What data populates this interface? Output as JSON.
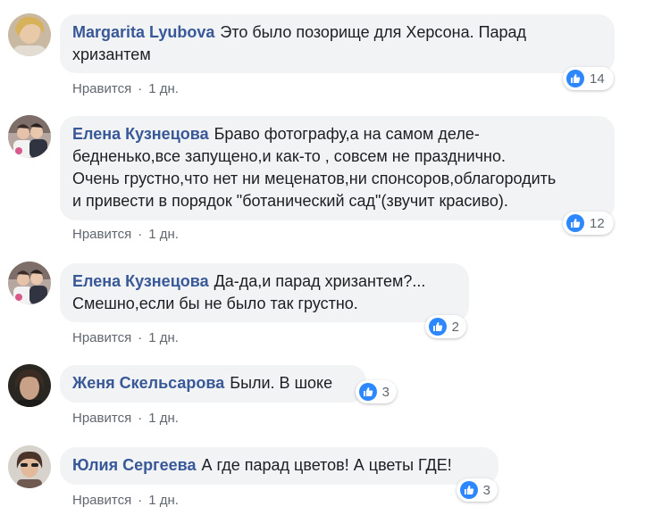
{
  "comments": [
    {
      "author": "Margarita Lyubova",
      "lines": [
        "Это было позорище для Херсона. Парад",
        "хризантем"
      ],
      "likes": "14",
      "action": "Нравится",
      "time": "1 дн."
    },
    {
      "author": "Елена Кузнецова",
      "lines": [
        "Браво фотографу,а на самом деле-",
        "бедненько,все запущено,и как-то , совсем не празднично.",
        "Очень грустно,что нет ни меценатов,ни спонсоров,облагородить",
        "и привести в порядок \"ботанический сад\"(звучит красиво)."
      ],
      "likes": "12",
      "action": "Нравится",
      "time": "1 дн."
    },
    {
      "author": "Елена Кузнецова",
      "lines": [
        "Да-да,и парад хризантем?...",
        "Смешно,если бы не было так грустно."
      ],
      "likes": "2",
      "action": "Нравится",
      "time": "1 дн."
    },
    {
      "author": "Женя Скельсарова",
      "lines": [
        "Были. В шоке"
      ],
      "likes": "3",
      "action": "Нравится",
      "time": "1 дн."
    },
    {
      "author": "Юлия Сергеева",
      "lines": [
        "А где парад цветов! А цветы ГДЕ!"
      ],
      "likes": "3",
      "action": "Нравится",
      "time": "1 дн."
    }
  ],
  "colors": {
    "author": "#385898",
    "bubble": "#f2f3f5",
    "like": "#2d88ff",
    "meta": "#606770"
  }
}
